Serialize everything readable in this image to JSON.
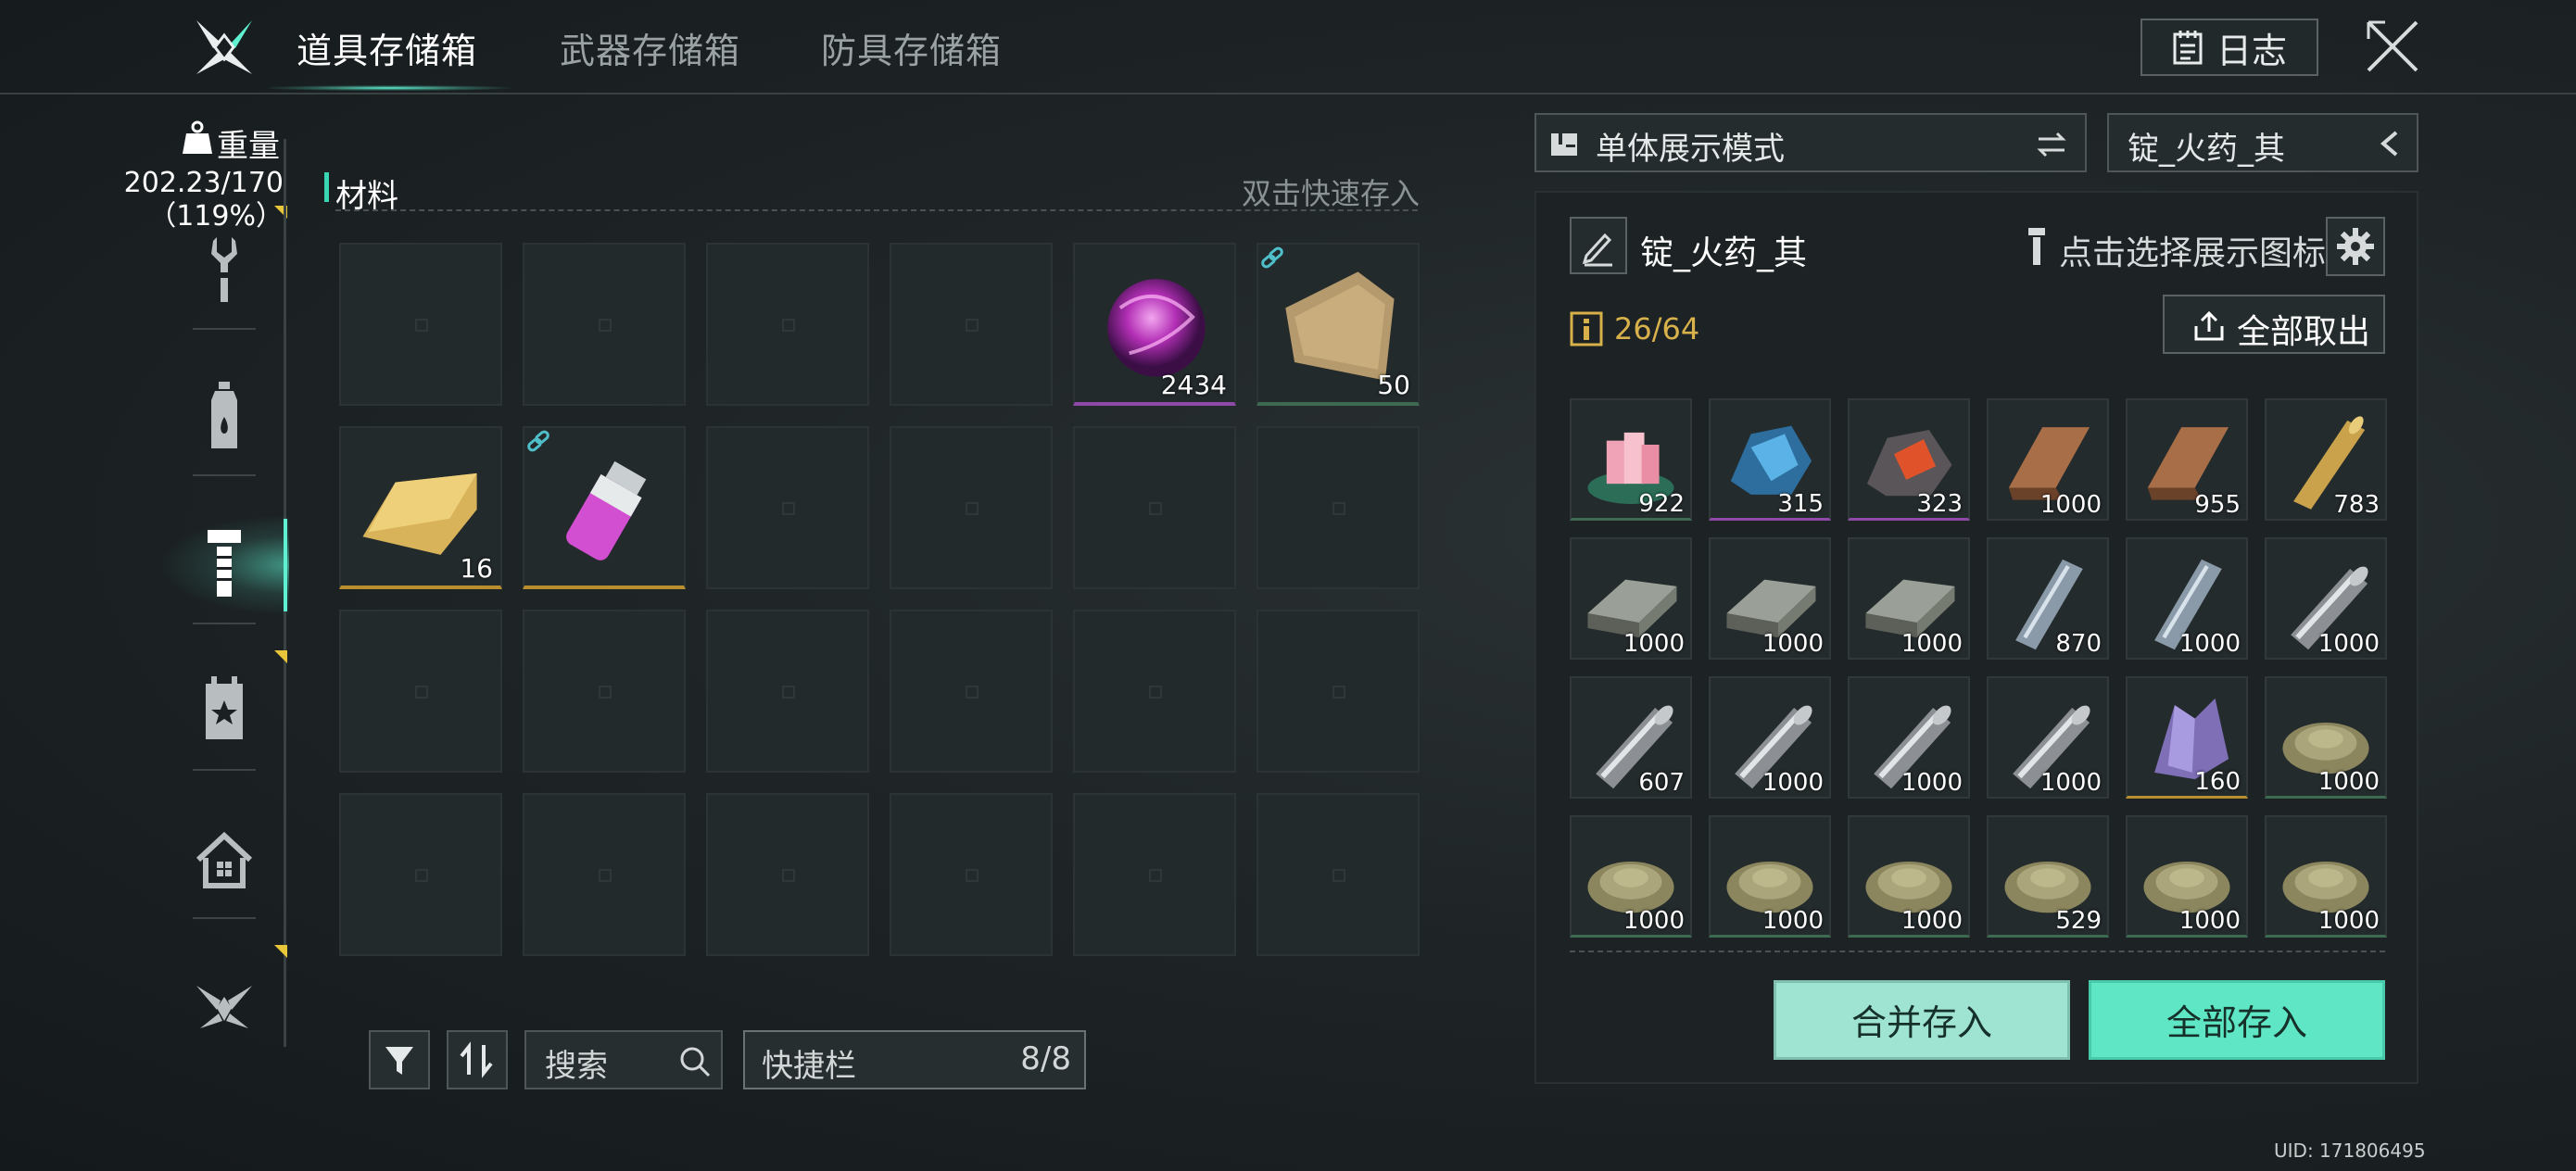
{
  "tabs": [
    {
      "label": "道具存储箱",
      "active": true
    },
    {
      "label": "武器存储箱",
      "active": false
    },
    {
      "label": "防具存储箱",
      "active": false
    }
  ],
  "log_button": "日志",
  "weight": {
    "label": "重量",
    "value": "202.23/170",
    "percent": "（119%）"
  },
  "sidebar_icons": [
    "wrench-icon",
    "bottle-icon",
    "bolt-icon",
    "star-calendar-icon",
    "home-icon",
    "emblem-icon"
  ],
  "inventory": {
    "section_title": "材料",
    "hint": "双击快速存入",
    "slots": [
      {
        "item": "",
        "count": ""
      },
      {
        "item": "",
        "count": ""
      },
      {
        "item": "",
        "count": ""
      },
      {
        "item": "",
        "count": ""
      },
      {
        "item": "purple-orb",
        "count": "2434"
      },
      {
        "item": "cloth",
        "count": "50",
        "linked": true
      },
      {
        "item": "gold-ingot",
        "count": "16"
      },
      {
        "item": "purple-vial",
        "count": "",
        "linked": true
      },
      {
        "item": "",
        "count": ""
      },
      {
        "item": "",
        "count": ""
      },
      {
        "item": "",
        "count": ""
      },
      {
        "item": "",
        "count": ""
      },
      {
        "item": "",
        "count": ""
      },
      {
        "item": "",
        "count": ""
      },
      {
        "item": "",
        "count": ""
      },
      {
        "item": "",
        "count": ""
      },
      {
        "item": "",
        "count": ""
      },
      {
        "item": "",
        "count": ""
      },
      {
        "item": "",
        "count": ""
      },
      {
        "item": "",
        "count": ""
      },
      {
        "item": "",
        "count": ""
      },
      {
        "item": "",
        "count": ""
      },
      {
        "item": "",
        "count": ""
      },
      {
        "item": "",
        "count": ""
      }
    ]
  },
  "search": {
    "placeholder": "搜索"
  },
  "quickbar": {
    "label": "快捷栏",
    "value": "8/8"
  },
  "storage": {
    "display_mode": "单体展示模式",
    "selected_name": "锭_火药_其",
    "item_name": "锭_火药_其",
    "pick_icon_label": "点击选择展示图标",
    "capacity": "26/64",
    "take_all": "全部取出",
    "slots": [
      {
        "item": "pink-crystal",
        "count": "922"
      },
      {
        "item": "blue-ore",
        "count": "315"
      },
      {
        "item": "red-ore",
        "count": "323"
      },
      {
        "item": "copper-ingot",
        "count": "1000"
      },
      {
        "item": "copper-ingot",
        "count": "955"
      },
      {
        "item": "gold-rod",
        "count": "783"
      },
      {
        "item": "iron-plate",
        "count": "1000"
      },
      {
        "item": "iron-plate",
        "count": "1000"
      },
      {
        "item": "iron-plate",
        "count": "1000"
      },
      {
        "item": "steel-bar",
        "count": "870"
      },
      {
        "item": "steel-bar",
        "count": "1000"
      },
      {
        "item": "steel-rod",
        "count": "1000"
      },
      {
        "item": "steel-rod",
        "count": "607"
      },
      {
        "item": "steel-rod",
        "count": "1000"
      },
      {
        "item": "steel-rod",
        "count": "1000"
      },
      {
        "item": "steel-rod",
        "count": "1000"
      },
      {
        "item": "violet-crystal",
        "count": "160"
      },
      {
        "item": "powder-pile",
        "count": "1000"
      },
      {
        "item": "powder-pile",
        "count": "1000"
      },
      {
        "item": "powder-pile",
        "count": "1000"
      },
      {
        "item": "powder-pile",
        "count": "1000"
      },
      {
        "item": "powder-pile",
        "count": "529"
      },
      {
        "item": "powder-pile",
        "count": "1000"
      },
      {
        "item": "powder-pile",
        "count": "1000"
      }
    ],
    "merge_button": "合并存入",
    "store_all_button": "全部存入"
  },
  "uid": "UID: 171806495",
  "colors": {
    "accent": "#5ef0d0",
    "gold": "#d8b14a",
    "button_light": "#9fe3d2",
    "button_bright": "#5fe6c4"
  }
}
